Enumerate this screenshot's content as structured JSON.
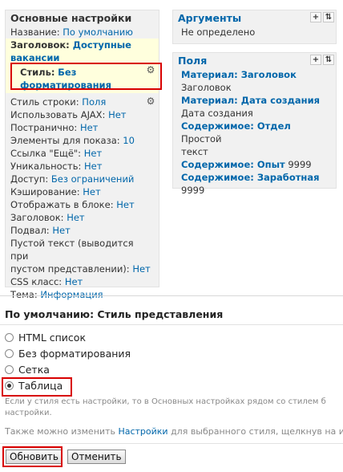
{
  "basic": {
    "title": "Основные настройки",
    "name_label": "Название:",
    "name_value": "По умолчанию",
    "header_label": "Заголовок:",
    "header_value_1": "Доступные",
    "header_value_2": "вакансии",
    "style_label": "Стиль:",
    "style_value_1": "Без",
    "style_value_2": "форматирования",
    "row_style_label": "Стиль строки:",
    "row_style_value": "Поля",
    "ajax_label": "Использовать AJAX:",
    "ajax_value": "Нет",
    "paged_label": "Постранично:",
    "paged_value": "Нет",
    "items_label": "Элементы для показа:",
    "items_value": "10",
    "more_label": "Ссылка \"Ещё\":",
    "more_value": "Нет",
    "distinct_label": "Уникальность:",
    "distinct_value": "Нет",
    "access_label": "Доступ:",
    "access_value": "Без ограничений",
    "cache_label": "Кэширование:",
    "cache_value": "Нет",
    "block_label": "Отображать в блоке:",
    "block_value": "Нет",
    "head_label": "Заголовок:",
    "head_value": "Нет",
    "footer_label": "Подвал:",
    "footer_value": "Нет",
    "empty_label_1": "Пустой текст (выводится при",
    "empty_label_2": "пустом представлении):",
    "empty_value": "Нет",
    "css_label": "CSS класс:",
    "css_value": "Нет",
    "theme_label": "Тема:",
    "theme_value": "Информация"
  },
  "arguments": {
    "title": "Аргументы",
    "value": "Не определено",
    "add_icon": "+",
    "sort_icon": "⇅"
  },
  "fields": {
    "title": "Поля",
    "add_icon": "+",
    "sort_icon": "⇅",
    "f1_link": "Материал: Заголовок",
    "f1_text": "Заголовок",
    "f2_link": "Материал: Дата создания",
    "f2_text": "Дата создания",
    "f3_link": "Содержимое: Отдел",
    "f3_text_1": "Простой",
    "f3_text_2": "текст",
    "f4_link": "Содержимое: Опыт",
    "f4_text": "9999",
    "f5_link": "Содержимое: Заработная",
    "f5_text": "9999"
  },
  "style_form": {
    "title": "По умолчанию: Стиль представления",
    "options": [
      "HTML список",
      "Без форматирования",
      "Сетка",
      "Таблица"
    ],
    "selected": "Таблица",
    "help_1": "Если у стиля есть настройки, то в Основных настройках рядом со стилем б",
    "help_2": "настройки.",
    "also_1": "Также можно изменить",
    "also_link": "Настройки",
    "also_2": "для выбранного стиля, щелкнув на и",
    "update_button": "Обновить",
    "cancel_button": "Отменить"
  }
}
